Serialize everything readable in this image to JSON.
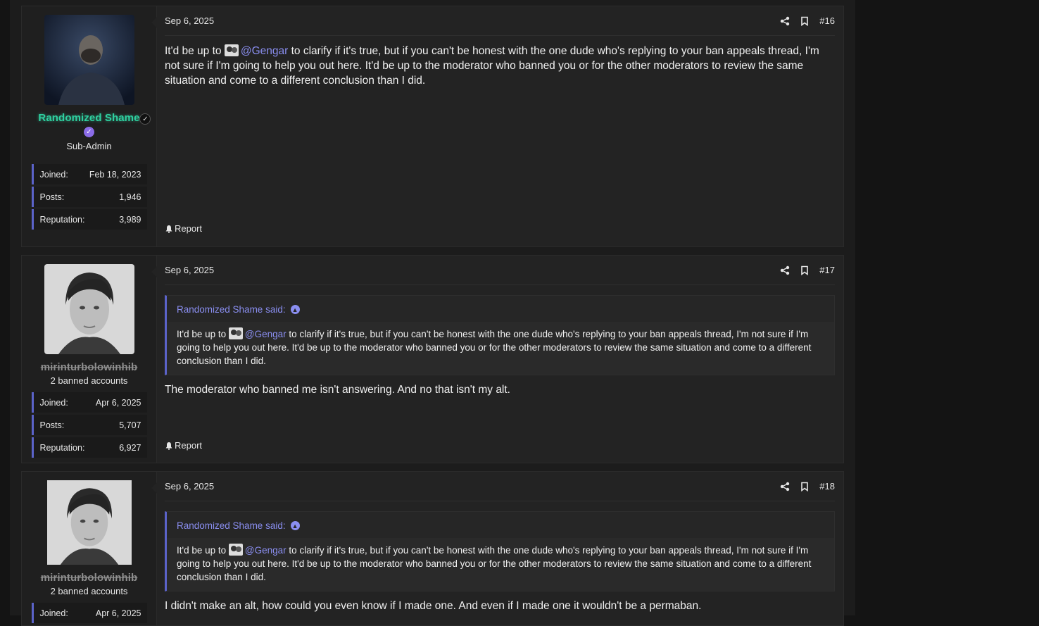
{
  "posts": [
    {
      "date": "Sep 6, 2025",
      "number": "#16",
      "user": {
        "name": "Randomized Shame",
        "title": "Sub-Admin",
        "style": "admin"
      },
      "stats": {
        "joined_label": "Joined:",
        "joined": "Feb 18, 2023",
        "posts_label": "Posts:",
        "posts": "1,946",
        "rep_label": "Reputation:",
        "rep": "3,989"
      },
      "body_prefix": "It'd be up to",
      "mention": "@Gengar",
      "body_suffix": "to clarify if it's true, but if you can't be honest with the one dude who's replying to your ban appeals thread, I'm not sure if I'm going to help you out here. It'd be up to the moderator who banned you or for the other moderators to review the same situation and come to a different conclusion than I did.",
      "report": "Report"
    },
    {
      "date": "Sep 6, 2025",
      "number": "#17",
      "user": {
        "name": "mirinturbolowinhib",
        "title": "2 banned accounts",
        "style": "banned"
      },
      "stats": {
        "joined_label": "Joined:",
        "joined": "Apr 6, 2025",
        "posts_label": "Posts:",
        "posts": "5,707",
        "rep_label": "Reputation:",
        "rep": "6,927"
      },
      "quote": {
        "author": "Randomized Shame said:",
        "prefix": "It'd be up to",
        "mention": "@Gengar",
        "suffix": "to clarify if it's true, but if you can't be honest with the one dude who's replying to your ban appeals thread, I'm not sure if I'm going to help you out here. It'd be up to the moderator who banned you or for the other moderators to review the same situation and come to a different conclusion than I did."
      },
      "reply": "The moderator who banned me isn't answering. And no that isn't my alt.",
      "report": "Report"
    },
    {
      "date": "Sep 6, 2025",
      "number": "#18",
      "user": {
        "name": "mirinturbolowinhib",
        "title": "2 banned accounts",
        "style": "banned"
      },
      "stats": {
        "joined_label": "Joined:",
        "joined": "Apr 6, 2025"
      },
      "quote": {
        "author": "Randomized Shame said:",
        "prefix": "It'd be up to",
        "mention": "@Gengar",
        "suffix": "to clarify if it's true, but if you can't be honest with the one dude who's replying to your ban appeals thread, I'm not sure if I'm going to help you out here. It'd be up to the moderator who banned you or for the other moderators to review the same situation and come to a different conclusion than I did."
      },
      "reply": "I didn't make an alt, how could you even know if I made one. And even if I made one it wouldn't be a permaban."
    }
  ],
  "colors": {
    "accent": "#5b63c9",
    "mention": "#8a8ef0",
    "admin_name": "#2fd0a0",
    "badge": "#8b6ce8"
  },
  "icons": [
    "share-icon",
    "bookmark-icon",
    "bell-icon",
    "verified-icon",
    "arrow-up-icon"
  ]
}
